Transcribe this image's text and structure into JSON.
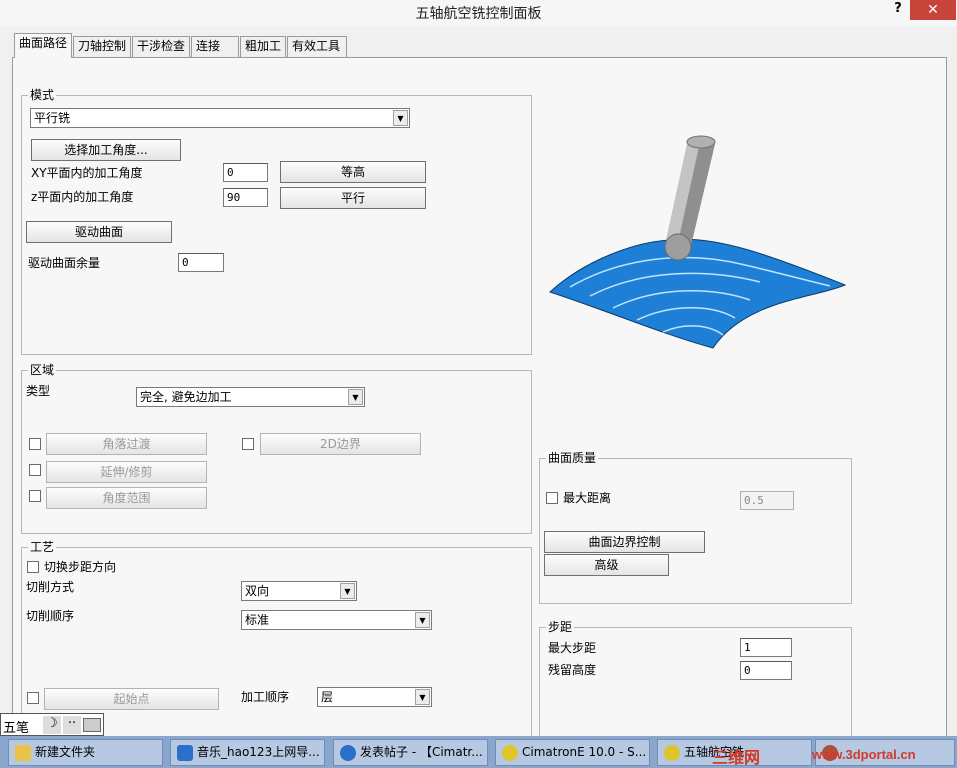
{
  "window": {
    "title": "五轴航空铣控制面板",
    "help": "?",
    "close": "✕"
  },
  "tabs": [
    "曲面路径",
    "刀轴控制",
    "干涉检查",
    "连接",
    "粗加工",
    "有效工具"
  ],
  "mode": {
    "label": "模式",
    "select_value": "平行铣",
    "choose_angle_btn": "选择加工角度...",
    "xy_label": "XY平面内的加工角度",
    "xy_value": "0",
    "contour_btn": "等高",
    "z_label": "z平面内的加工角度",
    "z_value": "90",
    "parallel_btn": "平行",
    "drive_btn": "驱动曲面",
    "drive_stock_label": "驱动曲面余量",
    "drive_stock_value": "0"
  },
  "region": {
    "label": "区域",
    "type_label": "类型",
    "type_value": "完全, 避免边加工",
    "corner_btn": "角落过渡",
    "boundary_btn": "2D边界",
    "extend_btn": "延伸/修剪",
    "angle_range_btn": "角度范围"
  },
  "process": {
    "label": "工艺",
    "switch_label": "切换步距方向",
    "cut_mode_label": "切削方式",
    "cut_mode_value": "双向",
    "cut_order_label": "切削顺序",
    "cut_order_value": "标准",
    "start_btn": "起始点",
    "machining_order_label": "加工顺序",
    "machining_order_value": "层"
  },
  "surface_quality": {
    "label": "曲面质量",
    "max_dist_label": "最大距离",
    "max_dist_value": "0.5",
    "edge_ctrl_btn": "曲面边界控制",
    "advanced_btn": "高级"
  },
  "step": {
    "label": "步距",
    "max_step_label": "最大步距",
    "max_step_value": "1",
    "scallop_label": "残留高度",
    "scallop_value": "0"
  },
  "ime": {
    "text": "五笔"
  },
  "taskbar": [
    {
      "label": "新建文件夹",
      "icon": "folder-icon"
    },
    {
      "label": "音乐_hao123上网导...",
      "icon": "browser-icon"
    },
    {
      "label": "发表帖子 - 【Cimatr...",
      "icon": "browser-icon"
    },
    {
      "label": "CimatronE 10.0 - S...",
      "icon": "cimatron-icon"
    },
    {
      "label": "五轴航空铣...",
      "icon": "cimatron-icon"
    },
    {
      "label": "",
      "icon": "app-icon"
    }
  ],
  "watermark": {
    "brand": "三维网",
    "url": "www.3dportal.cn"
  },
  "colors": {
    "surface": "#1e7fd6",
    "tool": "#9a9a9a",
    "close": "#c7443a",
    "taskbar": "#8aa6cc"
  }
}
